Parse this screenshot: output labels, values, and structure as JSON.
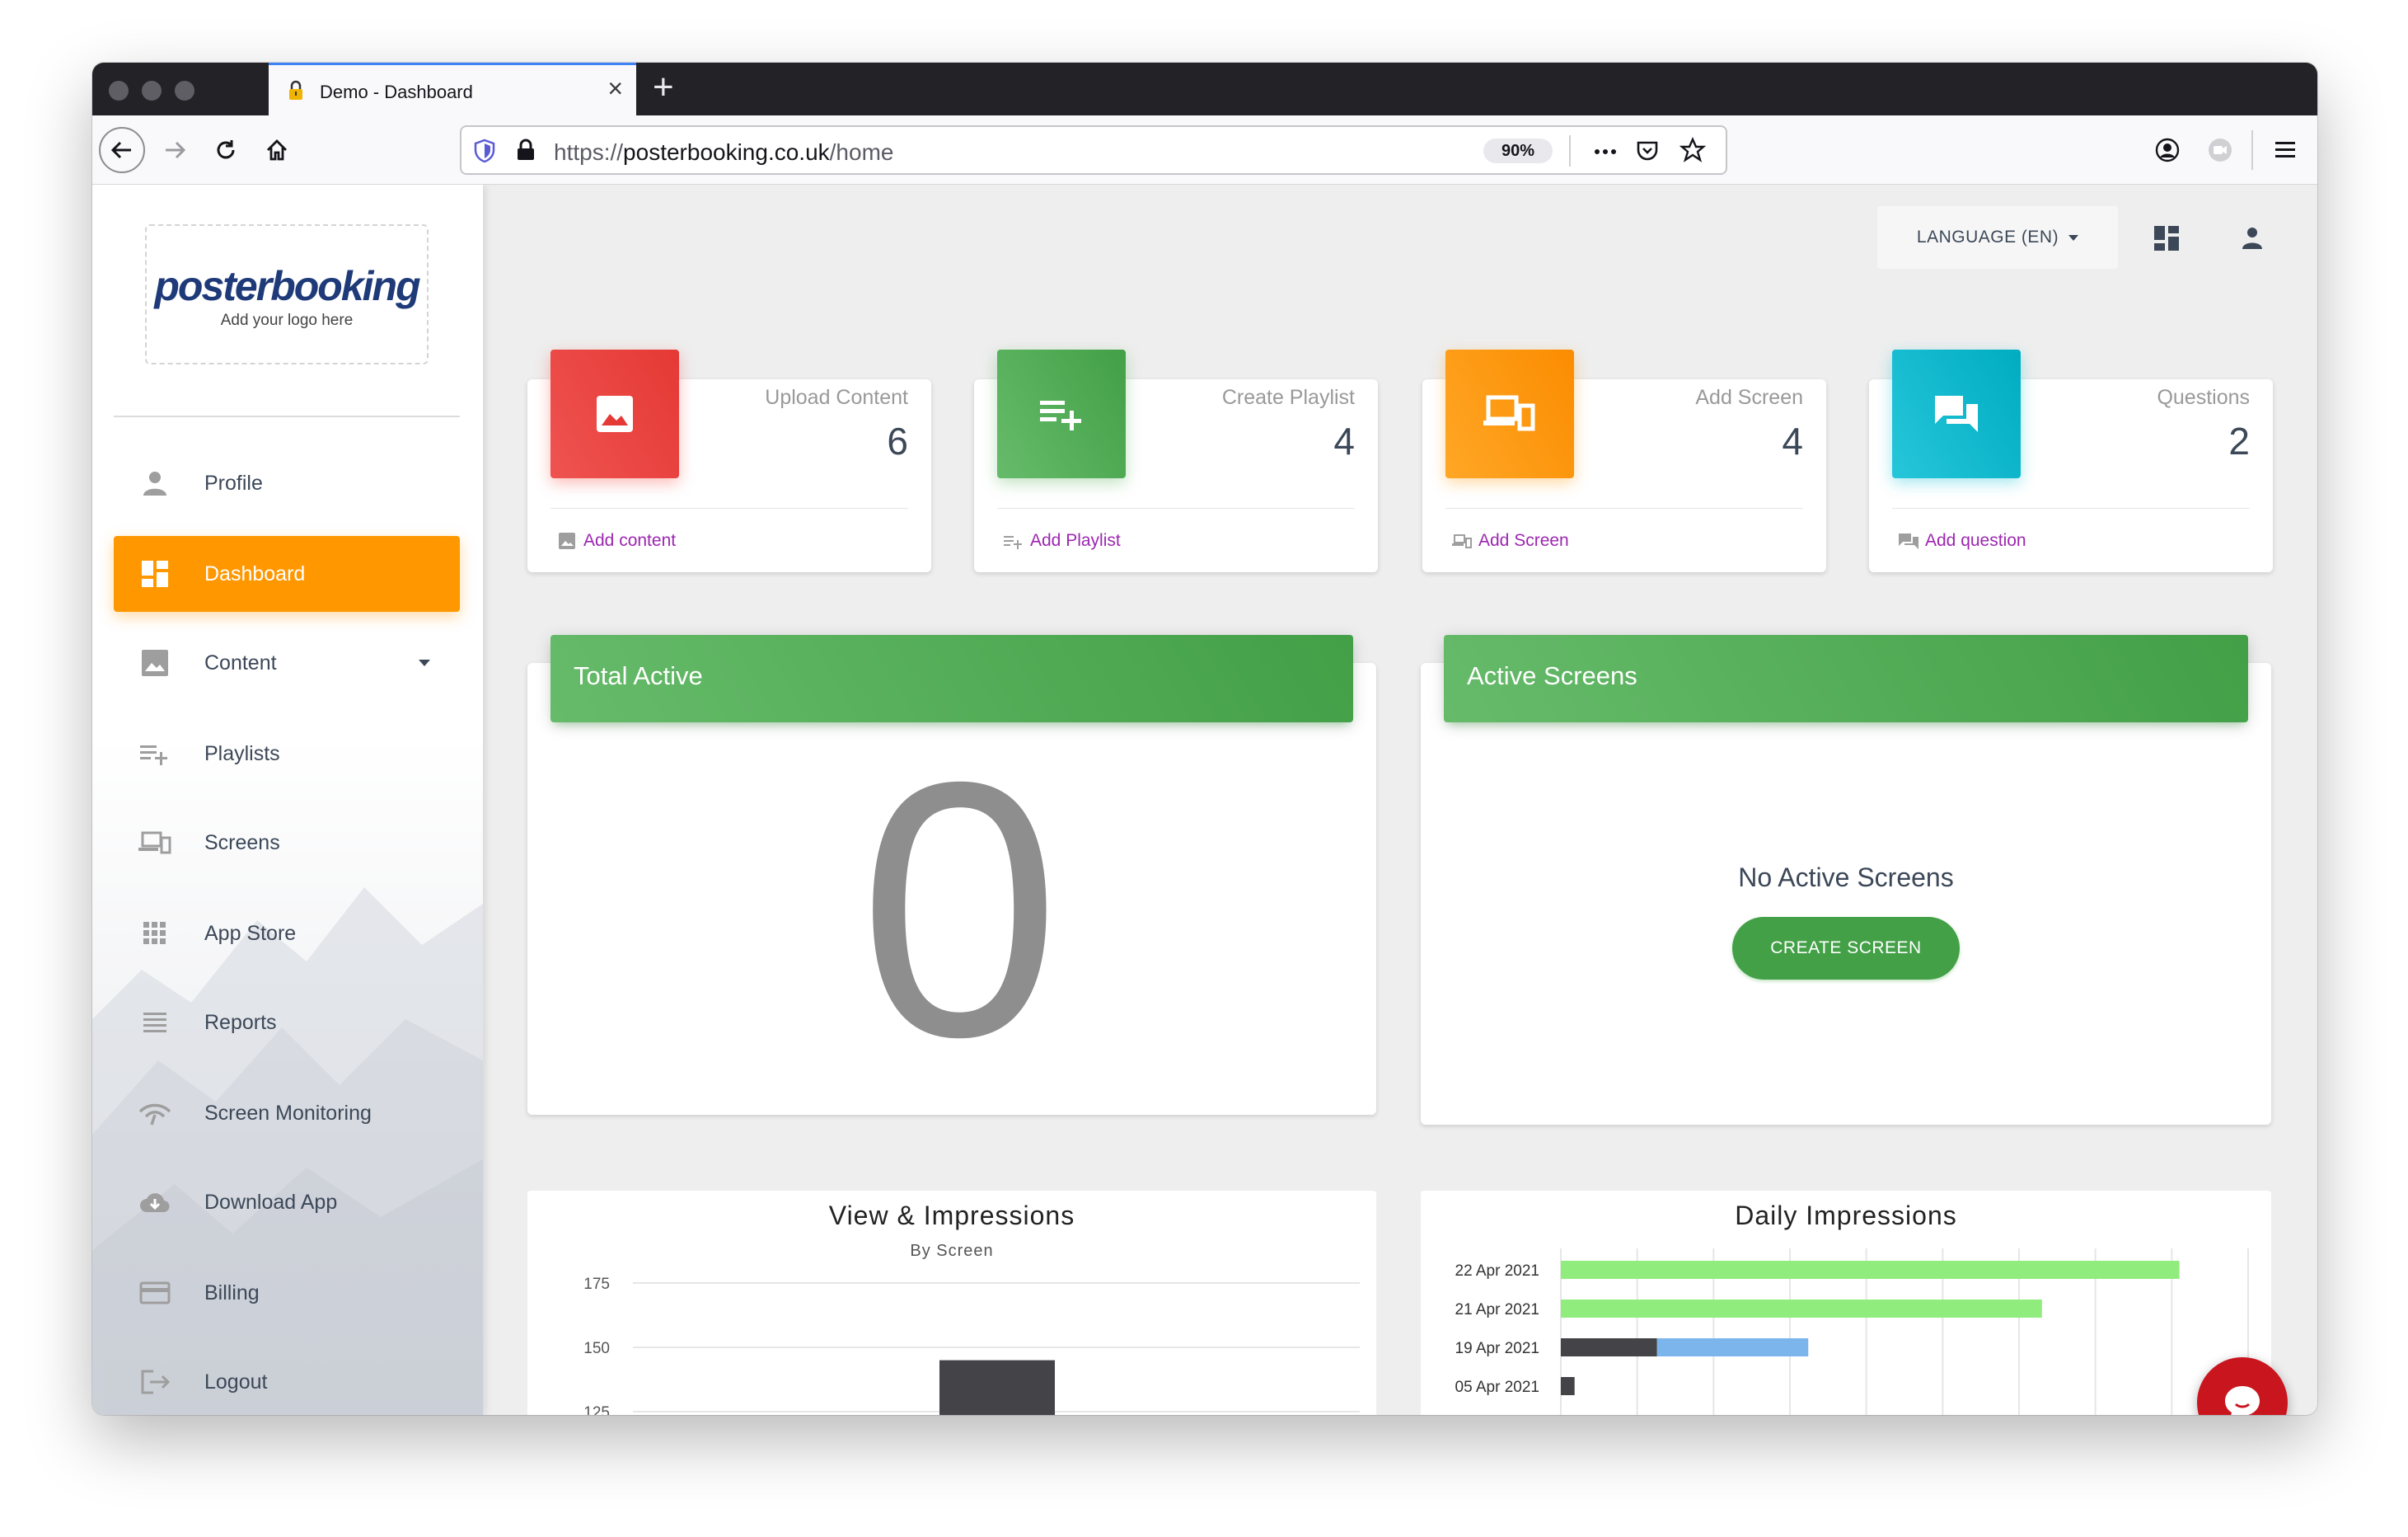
{
  "browser": {
    "tab_title": "Demo - Dashboard",
    "url_scheme": "https://",
    "url_host": "posterbooking.co.uk",
    "url_path": "/home",
    "zoom": "90%"
  },
  "sidebar": {
    "logo_main": "posterbooking",
    "logo_sub": "Add your logo here",
    "items": [
      {
        "label": "Profile",
        "icon": "person-icon"
      },
      {
        "label": "Dashboard",
        "icon": "dashboard-icon",
        "active": true
      },
      {
        "label": "Content",
        "icon": "image-icon",
        "has_submenu": true
      },
      {
        "label": "Playlists",
        "icon": "playlist-add-icon"
      },
      {
        "label": "Screens",
        "icon": "devices-icon"
      },
      {
        "label": "App Store",
        "icon": "apps-grid-icon"
      },
      {
        "label": "Reports",
        "icon": "reports-lines-icon"
      },
      {
        "label": "Screen Monitoring",
        "icon": "signal-icon"
      },
      {
        "label": "Download App",
        "icon": "cloud-download-icon"
      },
      {
        "label": "Billing",
        "icon": "credit-card-icon"
      },
      {
        "label": "Logout",
        "icon": "logout-icon"
      }
    ]
  },
  "header": {
    "language_label": "LANGUAGE (EN)"
  },
  "stats": [
    {
      "title": "Upload Content",
      "value": "6",
      "link": "Add content",
      "color": "#e53935"
    },
    {
      "title": "Create Playlist",
      "value": "4",
      "link": "Add Playlist",
      "color": "#43a047"
    },
    {
      "title": "Add Screen",
      "value": "4",
      "link": "Add Screen",
      "color": "#fb8c00"
    },
    {
      "title": "Questions",
      "value": "2",
      "link": "Add question",
      "color": "#00acc1"
    }
  ],
  "total_active": {
    "title": "Total Active",
    "value": "0"
  },
  "active_screens": {
    "title": "Active Screens",
    "empty_text": "No Active Screens",
    "button_label": "CREATE SCREEN"
  },
  "chart_data": [
    {
      "type": "bar",
      "title": "View & Impressions",
      "subtitle": "By Screen",
      "y_ticks": [
        "175",
        "150",
        "125"
      ],
      "ylim": [
        125,
        175
      ],
      "series": [
        {
          "values": [
            145
          ],
          "color": "#434348"
        }
      ]
    },
    {
      "type": "bar",
      "orientation": "horizontal",
      "stacked": true,
      "title": "Daily Impressions",
      "categories": [
        "22 Apr 2021",
        "21 Apr 2021",
        "19 Apr 2021",
        "05 Apr 2021"
      ],
      "series": [
        {
          "color": "#434348",
          "values": [
            0,
            0,
            14,
            2
          ]
        },
        {
          "color": "#7cb5ec",
          "values": [
            0,
            0,
            22,
            0
          ]
        },
        {
          "color": "#90ed7d",
          "values": [
            90,
            70,
            0,
            0
          ]
        }
      ],
      "grid_lines": 9
    }
  ]
}
